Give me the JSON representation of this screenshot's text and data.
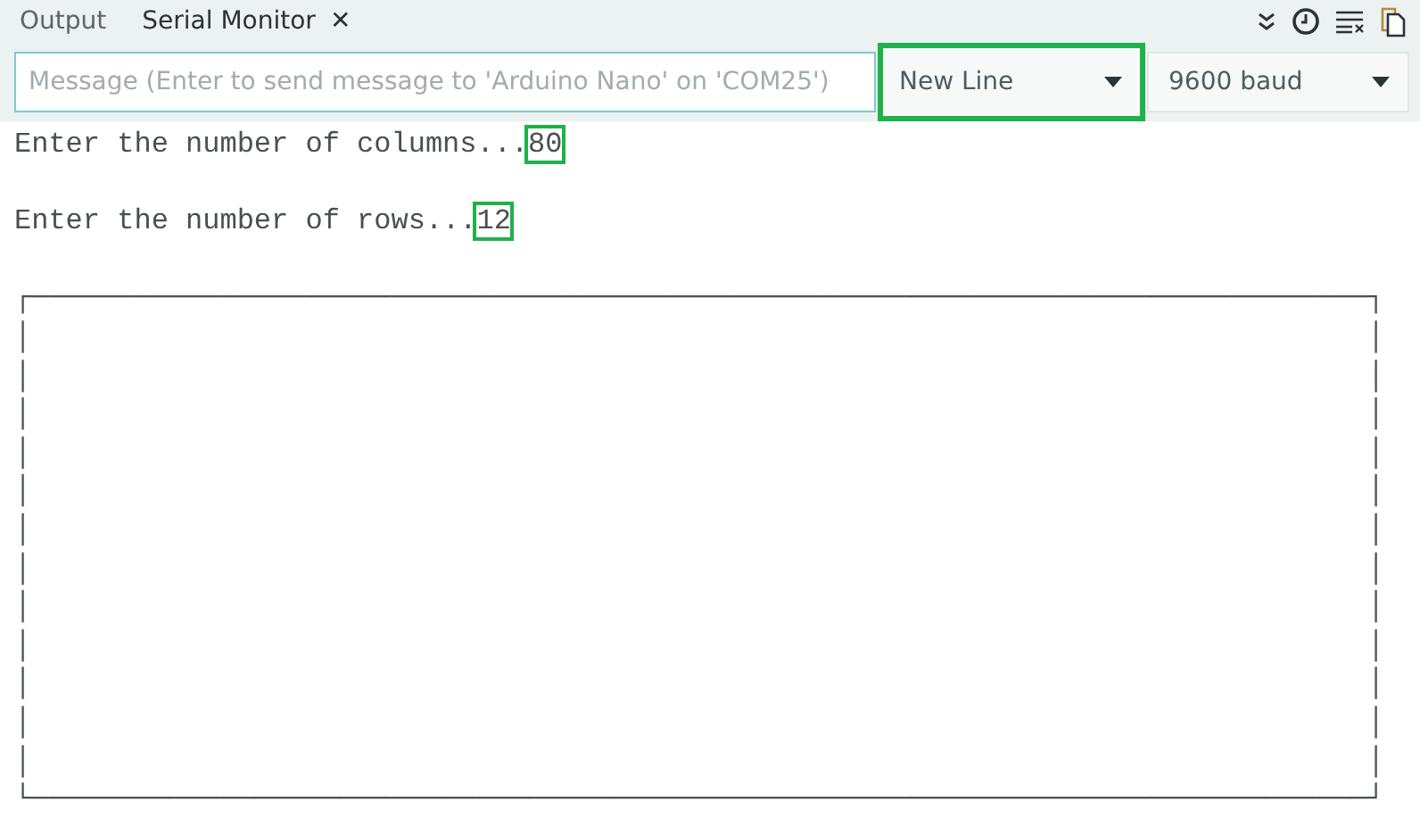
{
  "tabs": [
    {
      "label": "Output",
      "selected": false
    },
    {
      "label": "Serial Monitor",
      "selected": true,
      "close": "✕"
    }
  ],
  "message_field": {
    "placeholder": "Message (Enter to send message to 'Arduino Nano' on 'COM25')"
  },
  "dropdowns": [
    {
      "value": "New Line",
      "highlighted": true
    },
    {
      "value": "9600 baud",
      "highlighted": false
    }
  ],
  "output": {
    "lines": [
      {
        "kind": "prompt",
        "text": "Enter the number of columns...",
        "value": "80",
        "highlighted": true
      },
      {
        "kind": "blank"
      },
      {
        "kind": "prompt",
        "text": "Enter the number of rows...",
        "value": "12",
        "highlighted": true
      },
      {
        "kind": "blank"
      },
      {
        "kind": "text",
        "text": "┌──────────────────────────────────────────────────────────────────────────────┐"
      },
      {
        "kind": "text",
        "text": "│                                                                              │"
      },
      {
        "kind": "text",
        "text": "│                                                                              │"
      },
      {
        "kind": "text",
        "text": "│                                                                              │"
      },
      {
        "kind": "text",
        "text": "│                                                                              │"
      },
      {
        "kind": "text",
        "text": "│                                                                              │"
      },
      {
        "kind": "text",
        "text": "│                                                                              │"
      },
      {
        "kind": "text",
        "text": "│                                                                              │"
      },
      {
        "kind": "text",
        "text": "│                                                                              │"
      },
      {
        "kind": "text",
        "text": "│                                                                              │"
      },
      {
        "kind": "text",
        "text": "│                                                                              │"
      },
      {
        "kind": "text",
        "text": "│                                                                              │"
      },
      {
        "kind": "text",
        "text": "│                                                                              │"
      },
      {
        "kind": "text",
        "text": "└──────────────────────────────────────────────────────────────────────────────┘"
      }
    ]
  }
}
